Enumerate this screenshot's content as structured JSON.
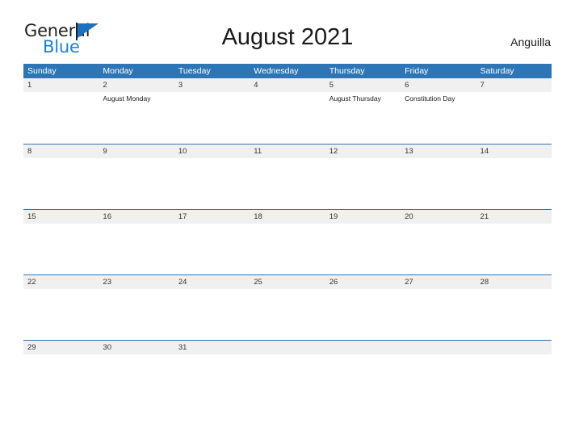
{
  "brand": {
    "name_part1": "General",
    "name_part2": "Blue",
    "flag_icon": "flag-triangle-icon"
  },
  "header": {
    "title": "August 2021",
    "country": "Anguilla"
  },
  "calendar": {
    "weekday_headers": [
      "Sunday",
      "Monday",
      "Tuesday",
      "Wednesday",
      "Thursday",
      "Friday",
      "Saturday"
    ],
    "colors": {
      "header_blue": "#2e75b6",
      "band_gray": "#f0f0f0",
      "brand_blue": "#1b80d4",
      "text_dark": "#1a1a1a"
    },
    "weeks": [
      [
        {
          "day": "1",
          "events": []
        },
        {
          "day": "2",
          "events": [
            "August Monday"
          ]
        },
        {
          "day": "3",
          "events": []
        },
        {
          "day": "4",
          "events": []
        },
        {
          "day": "5",
          "events": [
            "August Thursday"
          ]
        },
        {
          "day": "6",
          "events": [
            "Constitution Day"
          ]
        },
        {
          "day": "7",
          "events": []
        }
      ],
      [
        {
          "day": "8",
          "events": []
        },
        {
          "day": "9",
          "events": []
        },
        {
          "day": "10",
          "events": []
        },
        {
          "day": "11",
          "events": []
        },
        {
          "day": "12",
          "events": []
        },
        {
          "day": "13",
          "events": []
        },
        {
          "day": "14",
          "events": []
        }
      ],
      [
        {
          "day": "15",
          "events": []
        },
        {
          "day": "16",
          "events": []
        },
        {
          "day": "17",
          "events": []
        },
        {
          "day": "18",
          "events": []
        },
        {
          "day": "19",
          "events": []
        },
        {
          "day": "20",
          "events": []
        },
        {
          "day": "21",
          "events": []
        }
      ],
      [
        {
          "day": "22",
          "events": []
        },
        {
          "day": "23",
          "events": []
        },
        {
          "day": "24",
          "events": []
        },
        {
          "day": "25",
          "events": []
        },
        {
          "day": "26",
          "events": []
        },
        {
          "day": "27",
          "events": []
        },
        {
          "day": "28",
          "events": []
        }
      ],
      [
        {
          "day": "29",
          "events": []
        },
        {
          "day": "30",
          "events": []
        },
        {
          "day": "31",
          "events": []
        },
        {
          "day": "",
          "events": []
        },
        {
          "day": "",
          "events": []
        },
        {
          "day": "",
          "events": []
        },
        {
          "day": "",
          "events": []
        }
      ]
    ]
  }
}
